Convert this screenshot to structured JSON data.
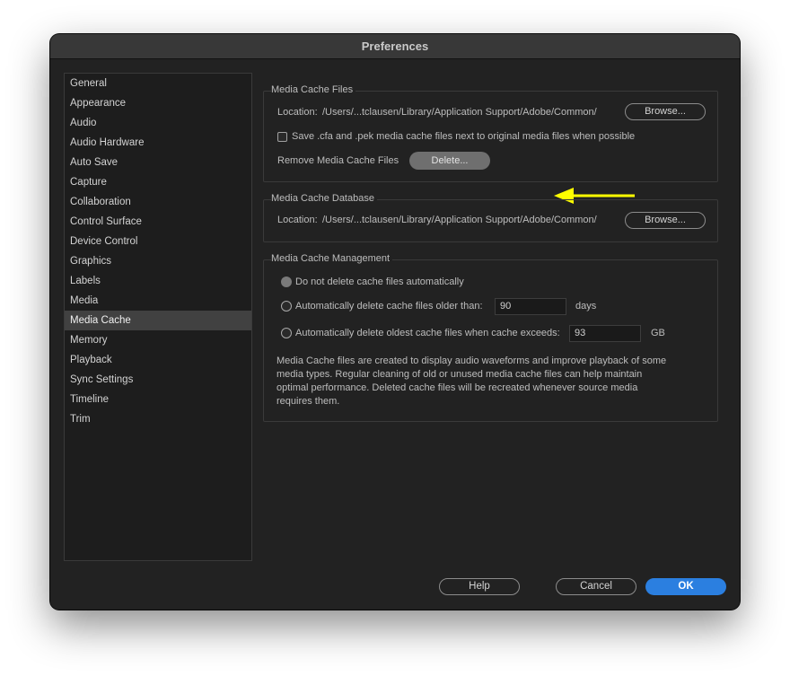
{
  "window": {
    "title": "Preferences"
  },
  "sidebar": {
    "items": [
      {
        "label": "General"
      },
      {
        "label": "Appearance"
      },
      {
        "label": "Audio"
      },
      {
        "label": "Audio Hardware"
      },
      {
        "label": "Auto Save"
      },
      {
        "label": "Capture"
      },
      {
        "label": "Collaboration"
      },
      {
        "label": "Control Surface"
      },
      {
        "label": "Device Control"
      },
      {
        "label": "Graphics"
      },
      {
        "label": "Labels"
      },
      {
        "label": "Media"
      },
      {
        "label": "Media Cache",
        "selected": true
      },
      {
        "label": "Memory"
      },
      {
        "label": "Playback"
      },
      {
        "label": "Sync Settings"
      },
      {
        "label": "Timeline"
      },
      {
        "label": "Trim"
      }
    ]
  },
  "media_cache_files": {
    "title": "Media Cache Files",
    "location_label": "Location:",
    "location_path": "/Users/...tclausen/Library/Application Support/Adobe/Common/",
    "browse_label": "Browse...",
    "save_next_label": "Save .cfa and .pek media cache files next to original media files when possible",
    "save_next_checked": false,
    "remove_label": "Remove Media Cache Files",
    "delete_label": "Delete..."
  },
  "media_cache_database": {
    "title": "Media Cache Database",
    "location_label": "Location:",
    "location_path": "/Users/...tclausen/Library/Application Support/Adobe/Common/",
    "browse_label": "Browse..."
  },
  "media_cache_management": {
    "title": "Media Cache Management",
    "option_no_delete": "Do not delete cache files automatically",
    "option_older_than": "Automatically delete cache files older than:",
    "older_than_value": "90",
    "older_than_unit": "days",
    "option_exceeds": "Automatically delete oldest cache files when cache exceeds:",
    "exceeds_value": "93",
    "exceeds_unit": "GB",
    "selected_option": "no_delete",
    "description": "Media Cache files are created to display audio waveforms and improve playback of some media types.  Regular cleaning of old or unused media cache files can help maintain optimal performance. Deleted cache files will be recreated whenever source media requires them."
  },
  "footer": {
    "help_label": "Help",
    "cancel_label": "Cancel",
    "ok_label": "OK"
  },
  "colors": {
    "accent": "#2b7fe0",
    "annotation_arrow": "#ffff00"
  }
}
